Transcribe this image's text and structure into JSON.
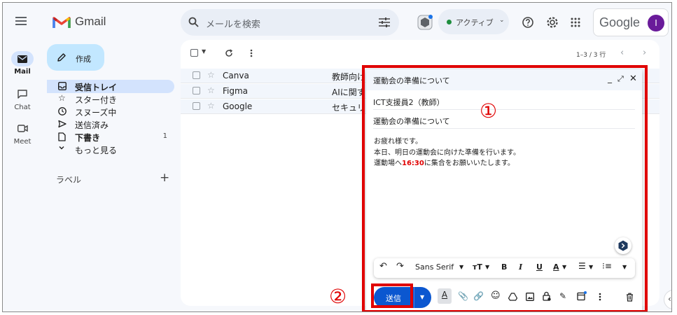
{
  "app": {
    "name": "Gmail"
  },
  "search": {
    "placeholder": "メールを検索"
  },
  "status": {
    "label": "アクティブ"
  },
  "brand": {
    "google_label": "Google",
    "avatar_letter": "I",
    "avatar_color": "#6a1b9a"
  },
  "rail": [
    {
      "label": "Mail"
    },
    {
      "label": "Chat"
    },
    {
      "label": "Meet"
    }
  ],
  "compose_button": {
    "label": "作成"
  },
  "nav": [
    {
      "label": "受信トレイ",
      "icon": "inbox-icon",
      "count": ""
    },
    {
      "label": "スター付き",
      "icon": "star-icon",
      "count": ""
    },
    {
      "label": "スヌーズ中",
      "icon": "clock-icon",
      "count": ""
    },
    {
      "label": "送信済み",
      "icon": "send-icon",
      "count": ""
    },
    {
      "label": "下書き",
      "icon": "draft-icon",
      "count": "1"
    },
    {
      "label": "もっと見る",
      "icon": "chevron-down-icon",
      "count": ""
    }
  ],
  "labels": {
    "title": "ラベル",
    "add": "+"
  },
  "toolbar": {
    "pagination": "1–3 / 3 行"
  },
  "emails": [
    {
      "sender": "Canva",
      "subject": "教師向け"
    },
    {
      "sender": "Figma",
      "subject": "AIに関す"
    },
    {
      "sender": "Google",
      "subject": "セキュリ"
    }
  ],
  "compose": {
    "title": "運動会の準備について",
    "to": "ICT支援員2（教師）",
    "subject": "運動会の準備について",
    "body_line1": "お疲れ様です。",
    "body_line2": "本日、明日の運動会に向けた準備を行います。",
    "body_line3_pre": "運動場へ",
    "body_line3_time": "16:30",
    "body_line3_post": "に集合をお願いいたします。",
    "font": "Sans Serif",
    "send_label": "送信"
  },
  "annotations": {
    "marker1": "①",
    "marker2": "②",
    "color": "#e00000"
  },
  "colors": {
    "accent": "#0b57d0",
    "compose_button_bg": "#c2e7ff",
    "selected_nav_bg": "#d3e3fd"
  }
}
